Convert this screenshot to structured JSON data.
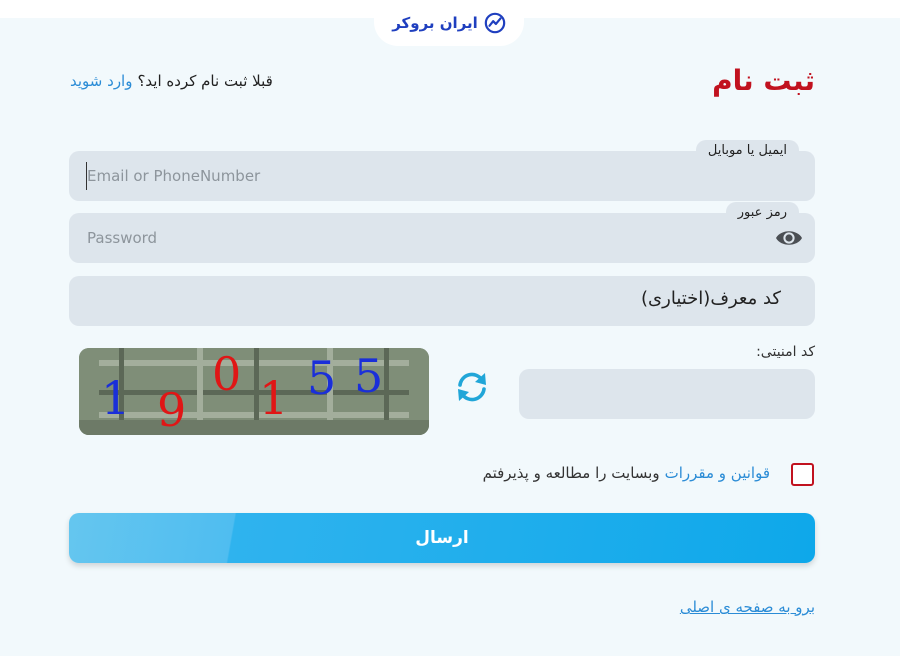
{
  "brand": {
    "name": "ایران بروکر",
    "color": "#1f3fbf"
  },
  "header": {
    "title": "ثبت نام"
  },
  "login_prompt": {
    "text": "قبلا ثبت نام کرده اید؟",
    "link": "وارد شوید"
  },
  "fields": {
    "identity": {
      "label": "ایمیل یا موبایل",
      "placeholder": "Email or PhoneNumber",
      "value": ""
    },
    "password": {
      "label": "رمز عبور",
      "placeholder": "Password",
      "value": ""
    },
    "referral": {
      "text": "کد معرف(اختیاری)"
    },
    "security": {
      "label": "کد امنیتی:",
      "value": "",
      "captcha_digits": [
        "1",
        "9",
        "0",
        "1",
        "5",
        "5"
      ]
    }
  },
  "terms": {
    "link": "قوانین و مقررات",
    "text": "وبسایت را مطالعه و پذیرفتم",
    "checked": false
  },
  "submit": {
    "label": "ارسال"
  },
  "footer": {
    "home_link": "برو به صفحه ی اصلی"
  },
  "icons": {
    "logo": "chart-trend-icon",
    "password_toggle": "eye-icon",
    "captcha_refresh": "refresh-icon"
  },
  "colors": {
    "accent": "#2b8cd6",
    "title": "#c1121f",
    "button": "#0ea8ea",
    "field_bg": "#dde5ec"
  }
}
